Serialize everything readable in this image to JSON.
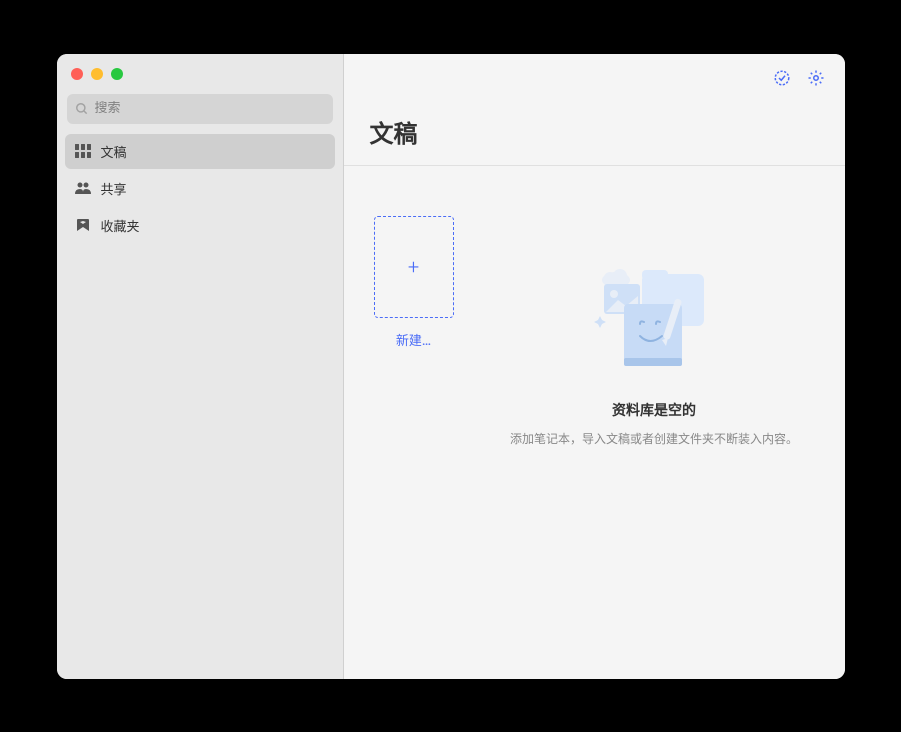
{
  "search": {
    "placeholder": "搜索"
  },
  "sidebar": {
    "items": [
      {
        "label": "文稿",
        "icon": "grid",
        "selected": true
      },
      {
        "label": "共享",
        "icon": "people",
        "selected": false
      },
      {
        "label": "收藏夹",
        "icon": "bookmark",
        "selected": false
      }
    ]
  },
  "main": {
    "title": "文稿",
    "new_card_label": "新建…",
    "empty_state": {
      "title": "资料库是空的",
      "subtitle": "添加笔记本，导入文稿或者创建文件夹不断装入内容。"
    }
  },
  "colors": {
    "accent": "#4a6cf7"
  }
}
